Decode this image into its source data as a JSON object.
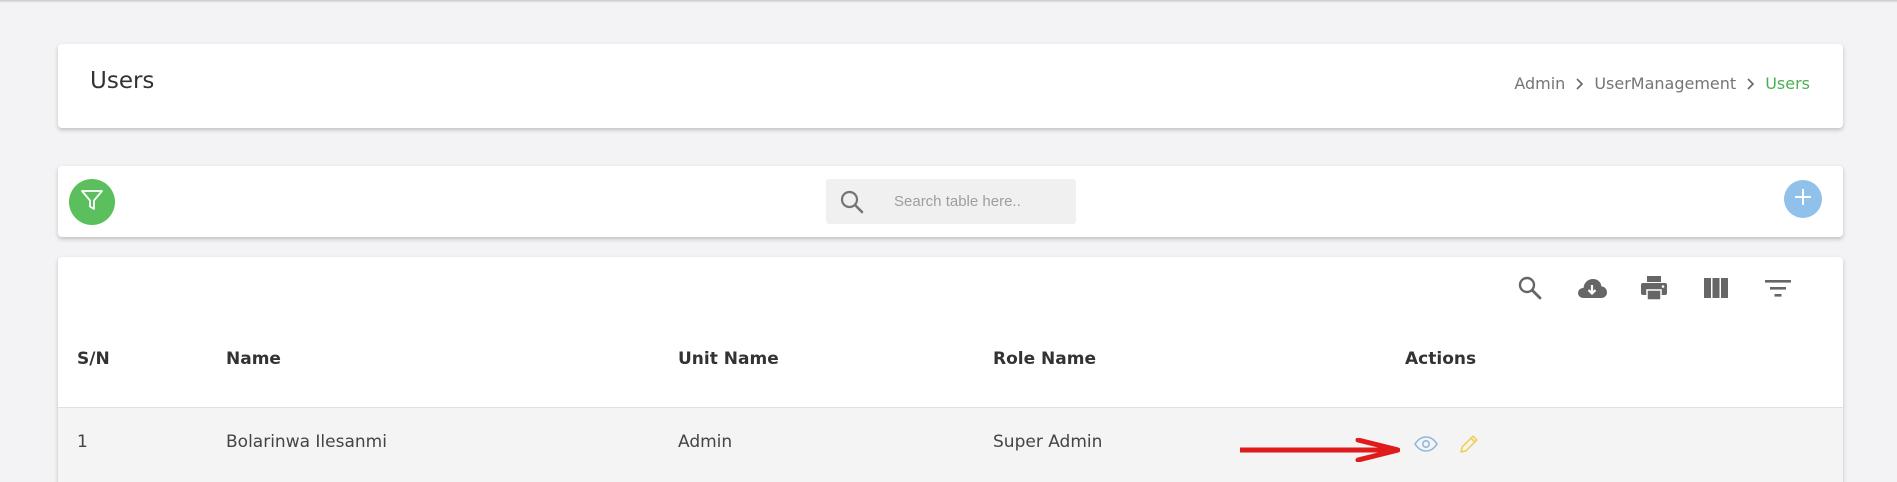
{
  "page": {
    "title": "Users",
    "breadcrumb": [
      "Admin",
      "UserManagement",
      "Users"
    ]
  },
  "toolbar": {
    "filter_icon": "filter-icon",
    "search_placeholder": "Search table here..",
    "search_value": "",
    "add_icon": "plus-icon"
  },
  "table_tools": [
    "search-icon",
    "cloud-download-icon",
    "print-icon",
    "columns-icon",
    "filter-list-icon"
  ],
  "table": {
    "headers": [
      "S/N",
      "Name",
      "Unit Name",
      "Role Name",
      "Actions"
    ],
    "rows": [
      {
        "sn": "1",
        "name": "Bolarinwa Ilesanmi",
        "unit": "Admin",
        "role": "Super Admin"
      }
    ]
  },
  "colors": {
    "accent_green": "#5cbf5e",
    "breadcrumb_active": "#4caf50",
    "add_button": "#90c1ea",
    "view_icon": "#90b8e0",
    "edit_icon": "#f0d060",
    "annotation_arrow": "#e01b1b"
  }
}
